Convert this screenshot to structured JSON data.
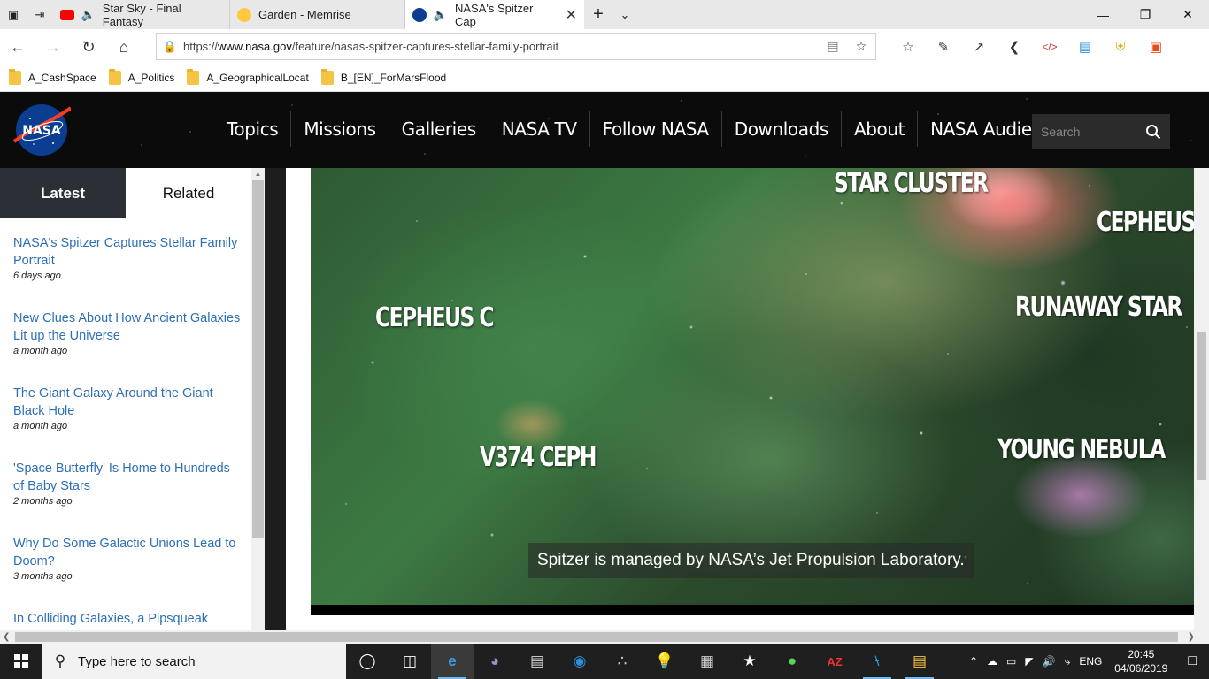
{
  "browser": {
    "tabs": [
      {
        "title": "Star Sky - Final Fantasy",
        "favicon_color": "#ff0000",
        "audio": true,
        "active": false
      },
      {
        "title": "Garden - Memrise",
        "favicon_color": "#ffc83d",
        "audio": false,
        "active": false
      },
      {
        "title": "NASA's Spitzer Cap",
        "favicon_color": "#0b3d91",
        "audio": true,
        "active": true
      }
    ],
    "address": {
      "prefix": "https://",
      "host": "www.nasa.gov",
      "path": "/feature/nasas-spitzer-captures-stellar-family-portrait"
    },
    "favorites": [
      "A_CashSpace",
      "A_Politics",
      "A_GeographicalLocat",
      "B_[EN]_ForMarsFlood"
    ]
  },
  "site": {
    "logo_text": "NASA",
    "nav": [
      "Topics",
      "Missions",
      "Galleries",
      "NASA TV",
      "Follow NASA",
      "Downloads",
      "About",
      "NASA Audiences"
    ],
    "search_placeholder": "Search"
  },
  "sidebar": {
    "tabs": [
      "Latest",
      "Related"
    ],
    "items": [
      {
        "title": "NASA's Spitzer Captures Stellar Family Portrait",
        "date": "6 days ago"
      },
      {
        "title": "New Clues About How Ancient Galaxies Lit up the Universe",
        "date": "a month ago"
      },
      {
        "title": "The Giant Galaxy Around the Giant Black Hole",
        "date": "a month ago"
      },
      {
        "title": "'Space Butterfly' Is Home to Hundreds of Baby Stars",
        "date": "2 months ago"
      },
      {
        "title": "Why Do Some Galactic Unions Lead to Doom?",
        "date": "3 months ago"
      },
      {
        "title": "In Colliding Galaxies, a Pipsqueak Shines",
        "date": ""
      }
    ]
  },
  "video": {
    "labels": [
      "STAR CLUSTER",
      "CEPHEUS B",
      "RUNAWAY STAR",
      "CEPHEUS C",
      "V374 CEPH",
      "YOUNG NEBULA"
    ],
    "caption": "Spitzer is managed by NASA’s Jet Propulsion Laboratory."
  },
  "taskbar": {
    "search_placeholder": "Type here to search",
    "language": "ENG",
    "time": "20:45",
    "date": "04/06/2019"
  }
}
